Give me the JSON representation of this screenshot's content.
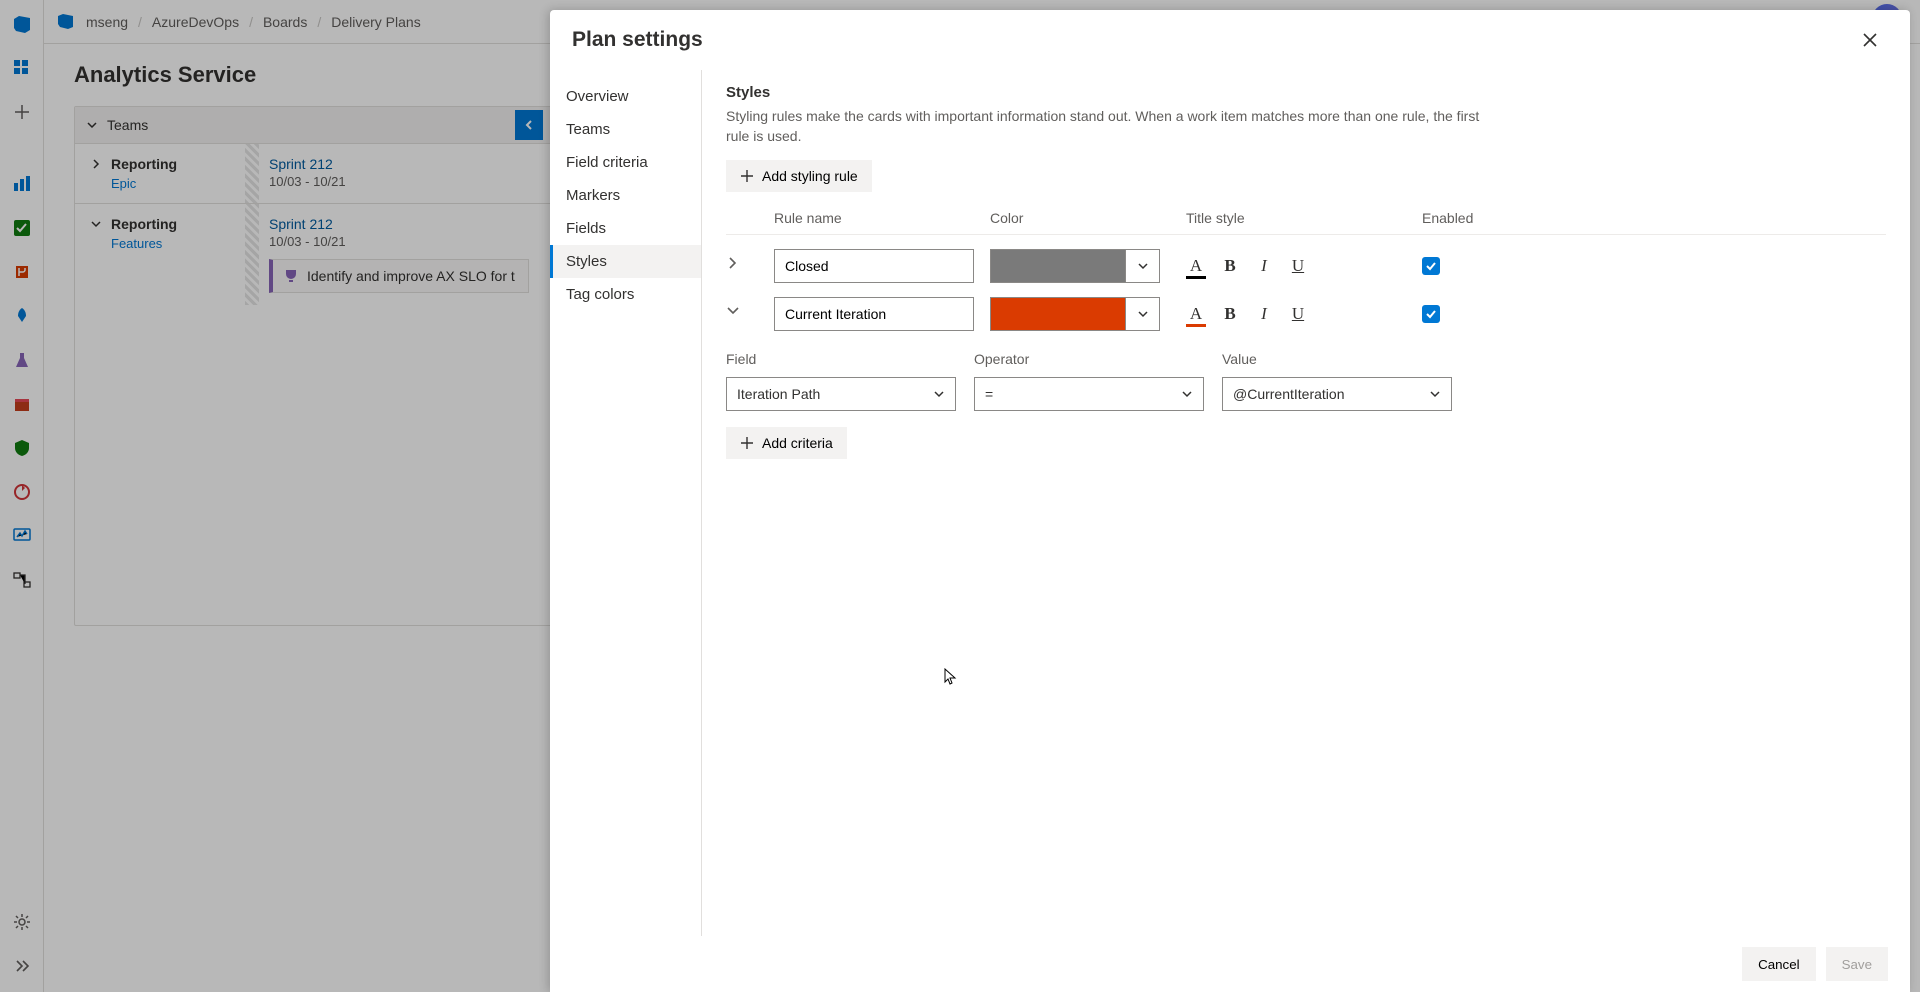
{
  "breadcrumbs": [
    "mseng",
    "AzureDevOps",
    "Boards",
    "Delivery Plans"
  ],
  "page_title": "Analytics Service",
  "teams_header": "Teams",
  "teams": [
    {
      "name": "Reporting",
      "subtype": "Epic",
      "sprint": "Sprint 212",
      "dates": "10/03 - 10/21"
    },
    {
      "name": "Reporting",
      "subtype": "Features",
      "sprint": "Sprint 212",
      "dates": "10/03 - 10/21",
      "card": "Identify and improve AX SLO for t"
    }
  ],
  "panel": {
    "title": "Plan settings",
    "nav": [
      "Overview",
      "Teams",
      "Field criteria",
      "Markers",
      "Fields",
      "Styles",
      "Tag colors"
    ],
    "selected_nav": "Styles",
    "section_heading": "Styles",
    "section_desc": "Styling rules make the cards with important information stand out. When a work item matches more than one rule, the first rule is used.",
    "add_rule_label": "Add styling rule",
    "cols": {
      "rule_name": "Rule name",
      "color": "Color",
      "title_style": "Title style",
      "enabled": "Enabled"
    },
    "rules": [
      {
        "name": "Closed",
        "color": "#7a7a7a",
        "title_underline_color": "#000000",
        "expanded": false,
        "enabled": true
      },
      {
        "name": "Current Iteration",
        "color": "#da3b01",
        "title_underline_color": "#da3b01",
        "expanded": true,
        "enabled": true
      }
    ],
    "criteria_labels": {
      "field": "Field",
      "operator": "Operator",
      "value": "Value"
    },
    "criteria": {
      "field": "Iteration Path",
      "operator": "=",
      "value": "@CurrentIteration"
    },
    "add_criteria_label": "Add criteria",
    "footer": {
      "cancel": "Cancel",
      "save": "Save"
    }
  },
  "rail_icons": [
    "azure-devops-logo",
    "grid-icon",
    "add-icon",
    "chart-icon",
    "checklist-icon",
    "branch-icon",
    "rocket-icon",
    "flask-icon",
    "package-icon",
    "shield-icon",
    "loop-icon",
    "monitor-icon",
    "flow-icon"
  ],
  "colors": {
    "accent": "#0078d4"
  }
}
